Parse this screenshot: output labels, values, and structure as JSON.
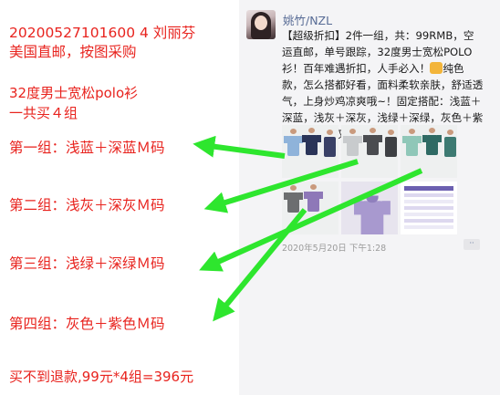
{
  "note": {
    "order_line": "20200527101600 4  刘丽芬",
    "order_line2": "美国直邮，按图采购",
    "product_line": "32度男士宽松polo衫",
    "product_line2": "一共买４组",
    "groups": [
      "第一组：浅蓝＋深蓝Ｍ码",
      "第二组：浅灰＋深灰Ｍ码",
      "第三组：浅绿＋深绿Ｍ码",
      "第四组：灰色＋紫色Ｍ码"
    ],
    "refund": "买不到退款,99元*4组=396元"
  },
  "moment": {
    "username": "姚竹/NZL",
    "text_before_icon": "【超级折扣】2件一组，共：99RMB，空运直邮，单号跟踪，32度男士宽松POLO衫！百年难遇折扣，人手必入！",
    "text_after_icon": "纯色款，怎么搭都好看，面料柔软亲肤，舒适透气，上身炒鸡凉爽哦~！固定搭配：浅蓝＋深蓝，浅灰＋深灰，浅绿＋深绿，灰色＋紫色。尺码表仅供参考。",
    "timestamp": "2020年5月20日 下午1:28",
    "more_label": "··",
    "thumb_icon": "thumbs-up-icon"
  },
  "colors": {
    "annotation_red": "#e8231e",
    "arrow_green": "#2ee62e",
    "link_blue": "#576b95"
  }
}
